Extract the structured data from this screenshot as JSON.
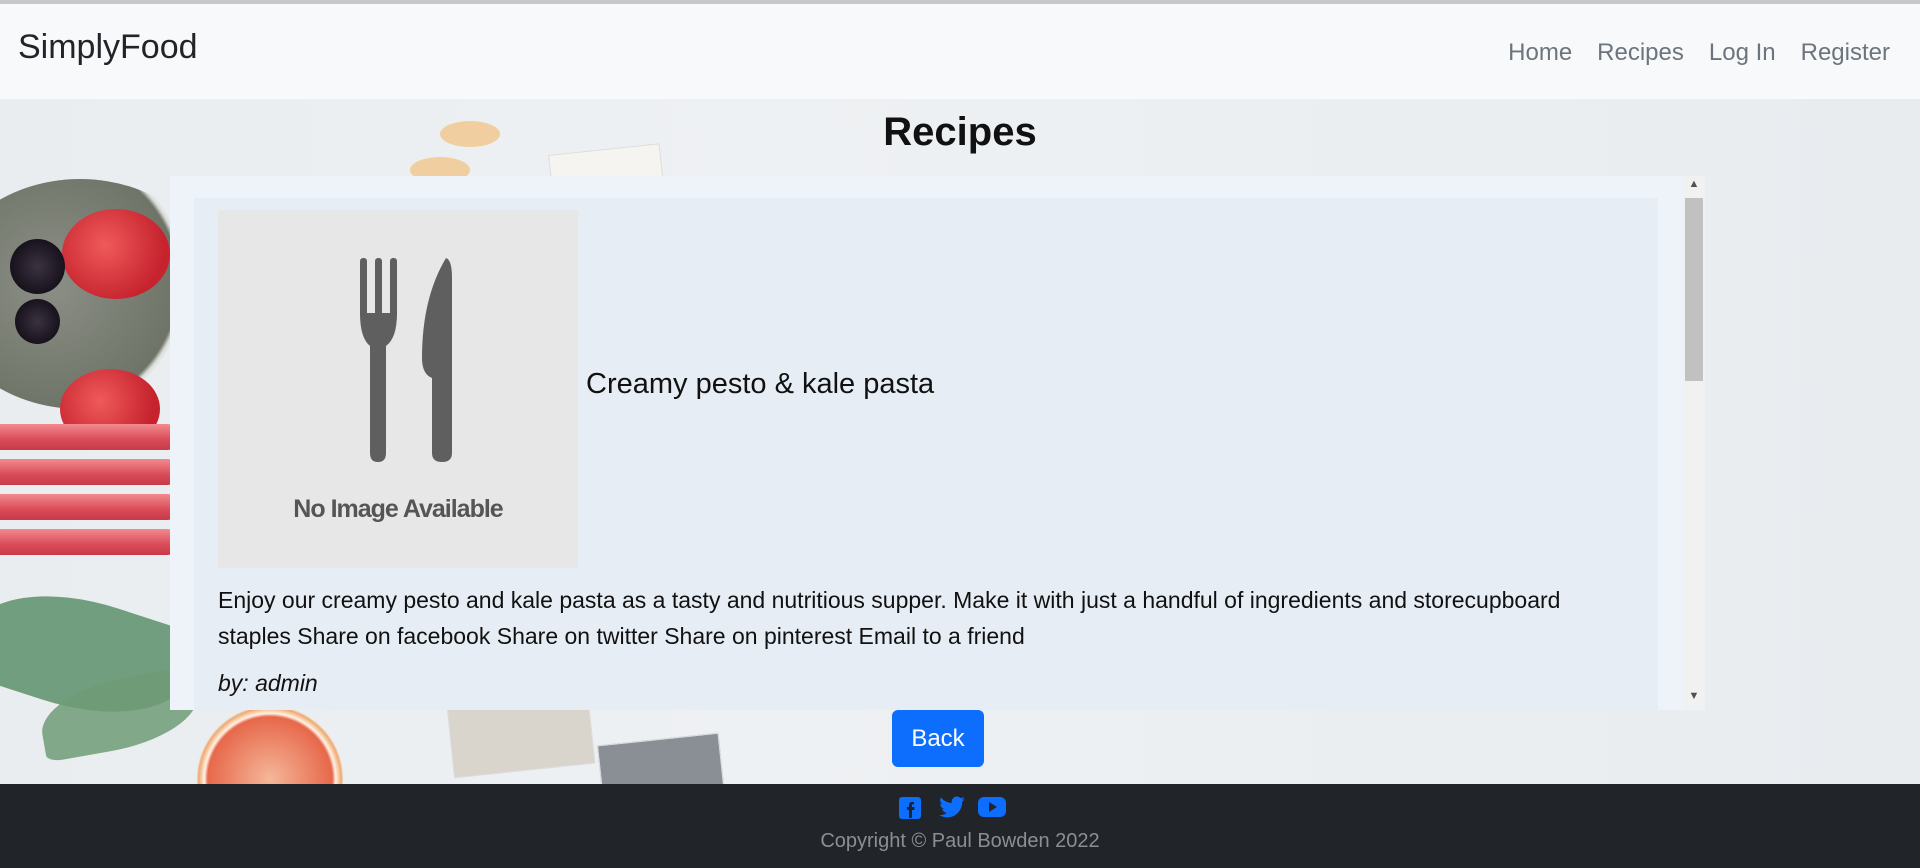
{
  "nav": {
    "brand": "SimplyFood",
    "links": [
      "Home",
      "Recipes",
      "Log In",
      "Register"
    ]
  },
  "page": {
    "title": "Recipes"
  },
  "recipe": {
    "image_placeholder_text": "No Image Available",
    "title": "Creamy pesto & kale pasta",
    "description": "Enjoy our creamy pesto and kale pasta as a tasty and nutritious supper. Make it with just a handful of ingredients and storecupboard staples Share on facebook Share on twitter Share on pinterest Email to a friend",
    "author": "by: admin"
  },
  "actions": {
    "back_label": "Back"
  },
  "footer": {
    "social_icons": [
      "facebook-icon",
      "twitter-icon",
      "youtube-icon"
    ],
    "copyright": "Copyright © Paul Bowden 2022"
  },
  "colors": {
    "primary": "#0d6efd",
    "footer_bg": "#212529",
    "navbar_bg": "#f8f9fa"
  }
}
